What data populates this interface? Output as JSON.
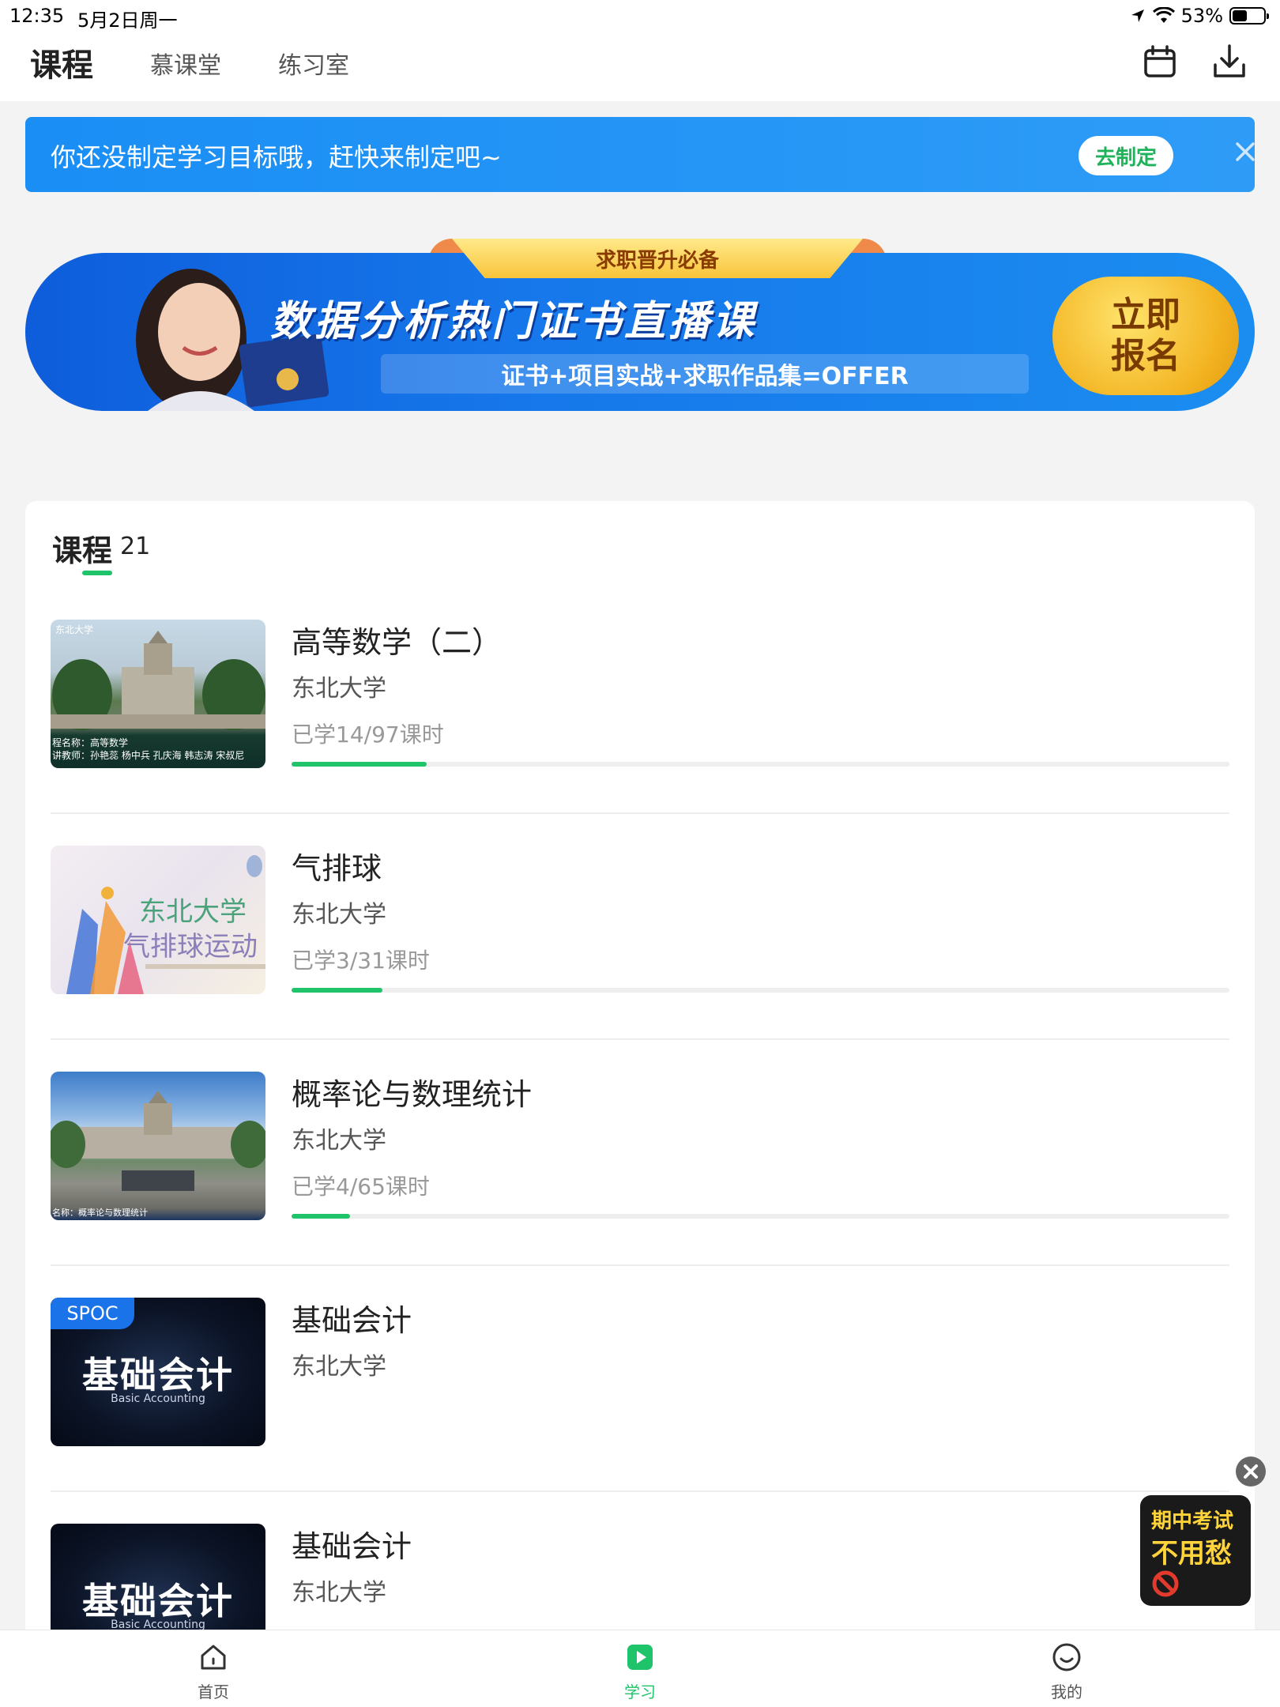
{
  "status_bar": {
    "time": "12:35",
    "date": "5月2日周一",
    "battery": "53%",
    "battery_level": 0.53
  },
  "header": {
    "tabs": [
      {
        "label": "课程",
        "active": true
      },
      {
        "label": "慕课堂",
        "active": false
      },
      {
        "label": "练习室",
        "active": false
      }
    ],
    "icons": [
      "calendar-icon",
      "download-icon"
    ]
  },
  "goal_banner": {
    "text": "你还没制定学习目标哦，赶快来制定吧~",
    "button": "去制定",
    "close_icon": "close-icon"
  },
  "promo": {
    "tag": "求职晋升必备",
    "title": "数据分析热门证书直播课",
    "subtitle": "证书+项目实战+求职作品集=OFFER",
    "cta_line1": "立即",
    "cta_line2": "报名"
  },
  "courses_section": {
    "title": "课程",
    "count": "21",
    "items": [
      {
        "title": "高等数学（二）",
        "school": "东北大学",
        "progress_text": "已学14/97课时",
        "progress_fraction": 0.144,
        "thumb_caption_1": "程名称：高等数学",
        "thumb_caption_2": "讲教师：孙艳蕊 杨中兵 孔庆海 韩志涛 宋叔尼",
        "thumb_caption_3": "东北大学"
      },
      {
        "title": "气排球",
        "school": "东北大学",
        "progress_text": "已学3/31课时",
        "progress_fraction": 0.097,
        "thumb_caption_1": "东北大学",
        "thumb_caption_2": "气排球运动"
      },
      {
        "title": "概率论与数理统计",
        "school": "东北大学",
        "progress_text": "已学4/65课时",
        "progress_fraction": 0.062,
        "thumb_caption_1": "名称：概率论与数理统计"
      },
      {
        "title": "基础会计",
        "school": "东北大学",
        "badge": "SPOC",
        "thumb_title": "基础会计",
        "thumb_sub": "Basic Accounting"
      },
      {
        "title": "基础会计",
        "school": "东北大学",
        "thumb_title": "基础会计",
        "thumb_sub": "Basic Accounting"
      }
    ]
  },
  "float_ad": {
    "line1": "期中考试",
    "line2": "不用愁"
  },
  "bottom_nav": [
    {
      "label": "首页",
      "icon": "home-icon",
      "active": false
    },
    {
      "label": "学习",
      "icon": "play-icon",
      "active": true
    },
    {
      "label": "我的",
      "icon": "profile-icon",
      "active": false
    }
  ],
  "colors": {
    "accent": "#1fc46a",
    "banner_blue": "#1a8ef5",
    "promo_yellow": "#f2b21f"
  }
}
